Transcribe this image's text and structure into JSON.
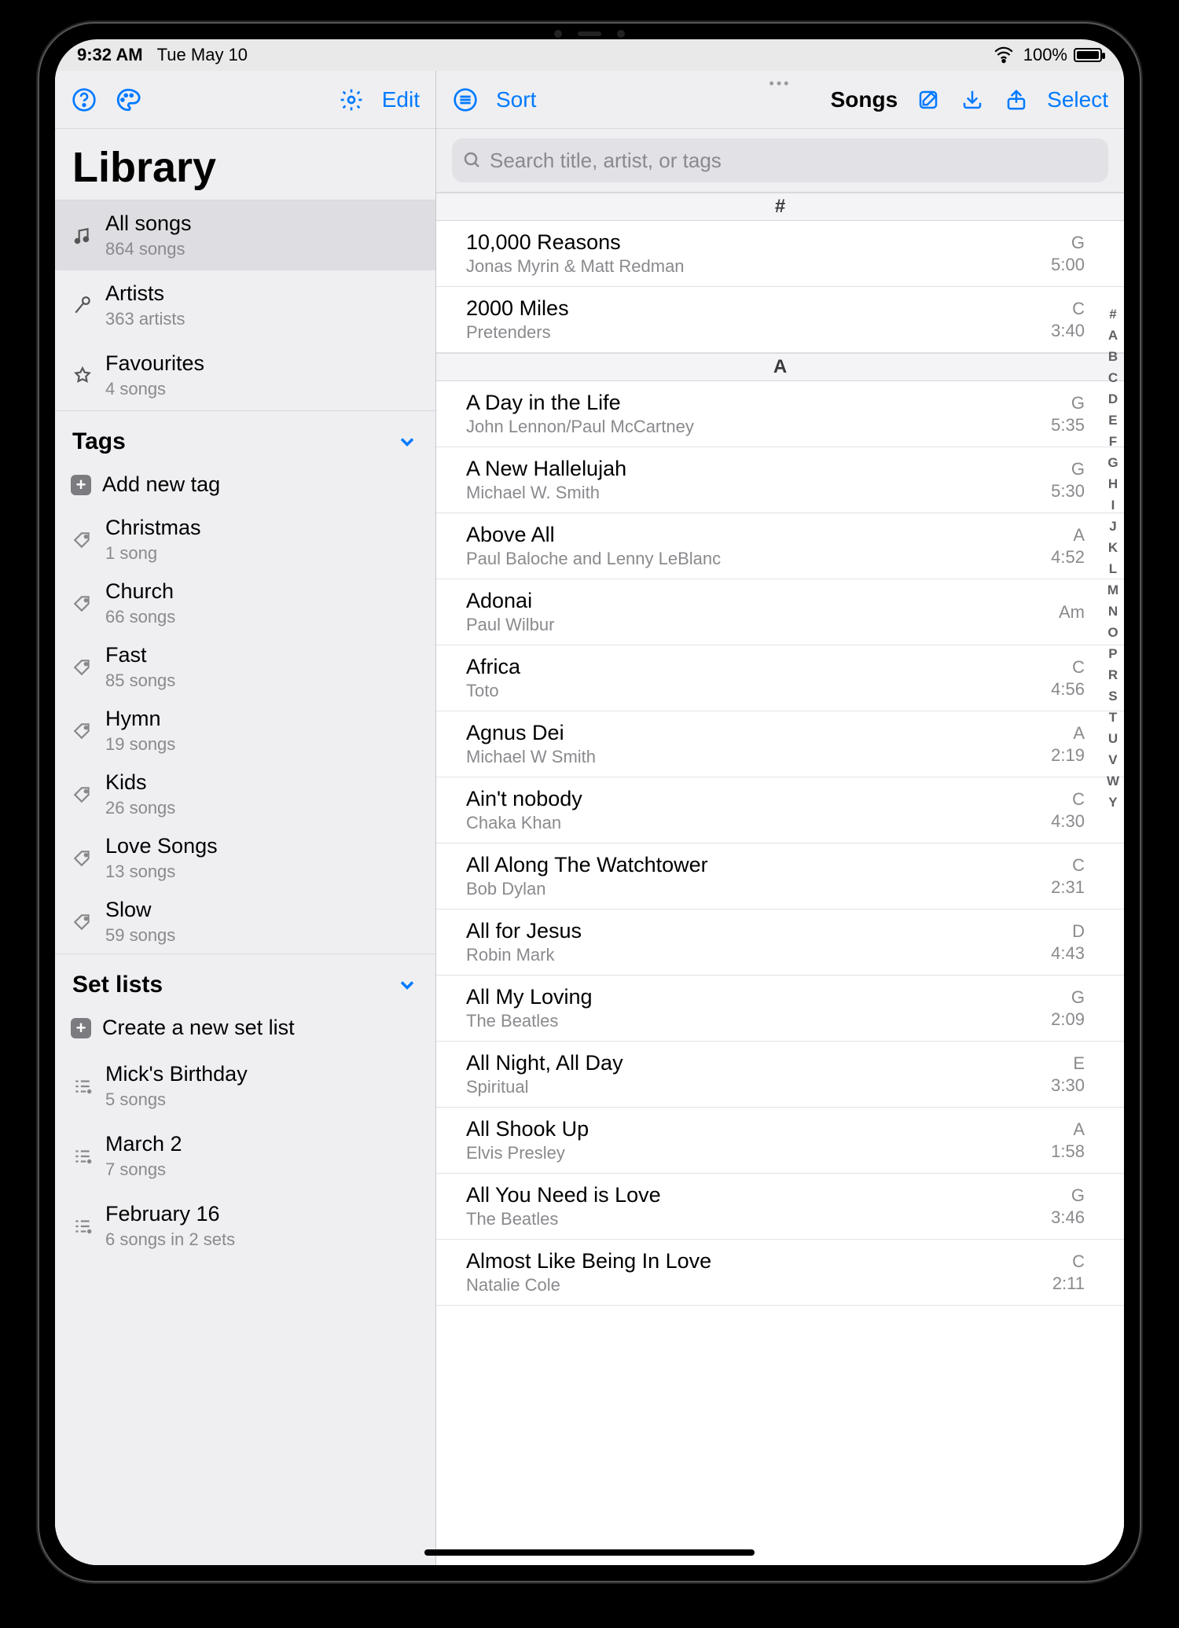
{
  "status": {
    "time": "9:32 AM",
    "date": "Tue May 10",
    "battery": "100%"
  },
  "sidebar": {
    "edit_label": "Edit",
    "title": "Library",
    "top": [
      {
        "icon": "music-notes-icon",
        "label": "All songs",
        "sub": "864 songs"
      },
      {
        "icon": "mic-icon",
        "label": "Artists",
        "sub": "363 artists"
      },
      {
        "icon": "star-icon",
        "label": "Favourites",
        "sub": "4 songs"
      }
    ],
    "tags_header": "Tags",
    "add_tag_label": "Add new tag",
    "tags": [
      {
        "label": "Christmas",
        "sub": "1 song"
      },
      {
        "label": "Church",
        "sub": "66 songs"
      },
      {
        "label": "Fast",
        "sub": "85 songs"
      },
      {
        "label": "Hymn",
        "sub": "19 songs"
      },
      {
        "label": "Kids",
        "sub": "26 songs"
      },
      {
        "label": "Love Songs",
        "sub": "13 songs"
      },
      {
        "label": "Slow",
        "sub": "59 songs"
      }
    ],
    "setlists_header": "Set lists",
    "create_setlist_label": "Create a new set list",
    "setlists": [
      {
        "label": "Mick's Birthday",
        "sub": "5 songs"
      },
      {
        "label": "March 2",
        "sub": "7 songs"
      },
      {
        "label": "February 16",
        "sub": "6 songs in 2 sets"
      }
    ]
  },
  "detail": {
    "sort_label": "Sort",
    "mode_label": "Songs",
    "select_label": "Select",
    "search_placeholder": "Search title, artist, or tags",
    "sections": [
      {
        "letter": "#",
        "songs": [
          {
            "title": "10,000 Reasons",
            "artist": "Jonas Myrin & Matt Redman",
            "key": "G",
            "dur": "5:00"
          },
          {
            "title": "2000 Miles",
            "artist": "Pretenders",
            "key": "C",
            "dur": "3:40"
          }
        ]
      },
      {
        "letter": "A",
        "songs": [
          {
            "title": "A Day in the Life",
            "artist": "John Lennon/Paul McCartney",
            "key": "G",
            "dur": "5:35"
          },
          {
            "title": "A New Hallelujah",
            "artist": "Michael W. Smith",
            "key": "G",
            "dur": "5:30"
          },
          {
            "title": "Above All",
            "artist": "Paul Baloche and Lenny LeBlanc",
            "key": "A",
            "dur": "4:52"
          },
          {
            "title": "Adonai",
            "artist": "Paul Wilbur",
            "key": "Am",
            "dur": ""
          },
          {
            "title": "Africa",
            "artist": "Toto",
            "key": "C",
            "dur": "4:56"
          },
          {
            "title": "Agnus Dei",
            "artist": "Michael W Smith",
            "key": "A",
            "dur": "2:19"
          },
          {
            "title": "Ain't nobody",
            "artist": "Chaka Khan",
            "key": "C",
            "dur": "4:30"
          },
          {
            "title": "All Along The Watchtower",
            "artist": "Bob Dylan",
            "key": "C",
            "dur": "2:31"
          },
          {
            "title": "All for Jesus",
            "artist": "Robin Mark",
            "key": "D",
            "dur": "4:43"
          },
          {
            "title": "All My Loving",
            "artist": "The Beatles",
            "key": "G",
            "dur": "2:09"
          },
          {
            "title": "All Night, All Day",
            "artist": "Spiritual",
            "key": "E",
            "dur": "3:30"
          },
          {
            "title": "All Shook Up",
            "artist": "Elvis Presley",
            "key": "A",
            "dur": "1:58"
          },
          {
            "title": "All You Need is Love",
            "artist": "The Beatles",
            "key": "G",
            "dur": "3:46"
          },
          {
            "title": "Almost Like Being In Love",
            "artist": "Natalie Cole",
            "key": "C",
            "dur": "2:11"
          }
        ]
      }
    ],
    "index": [
      "#",
      "A",
      "B",
      "C",
      "D",
      "E",
      "F",
      "G",
      "H",
      "I",
      "J",
      "K",
      "L",
      "M",
      "N",
      "O",
      "P",
      "R",
      "S",
      "T",
      "U",
      "V",
      "W",
      "Y"
    ]
  }
}
